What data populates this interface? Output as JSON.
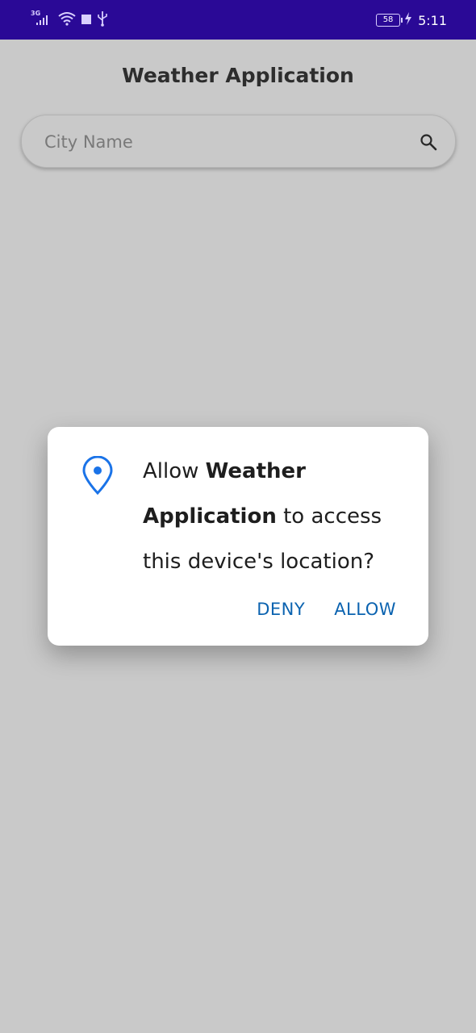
{
  "status_bar": {
    "network_type": "3G",
    "battery_level": "58",
    "time": "5:11",
    "icons": [
      "signal-icon",
      "wifi-icon",
      "stop-icon",
      "usb-icon",
      "battery-icon",
      "charging-icon"
    ]
  },
  "app": {
    "title": "Weather Application",
    "search": {
      "placeholder": "City Name",
      "value": "",
      "icon": "search-icon"
    }
  },
  "permission_dialog": {
    "icon": "location-pin-icon",
    "prefix": "Allow ",
    "app_name": "Weather Application",
    "suffix": " to access this device's location?",
    "deny_label": "DENY",
    "allow_label": "ALLOW"
  },
  "colors": {
    "status_bar": "#2a0996",
    "accent_button": "#0b63b0",
    "pin_icon": "#1a73e8"
  }
}
